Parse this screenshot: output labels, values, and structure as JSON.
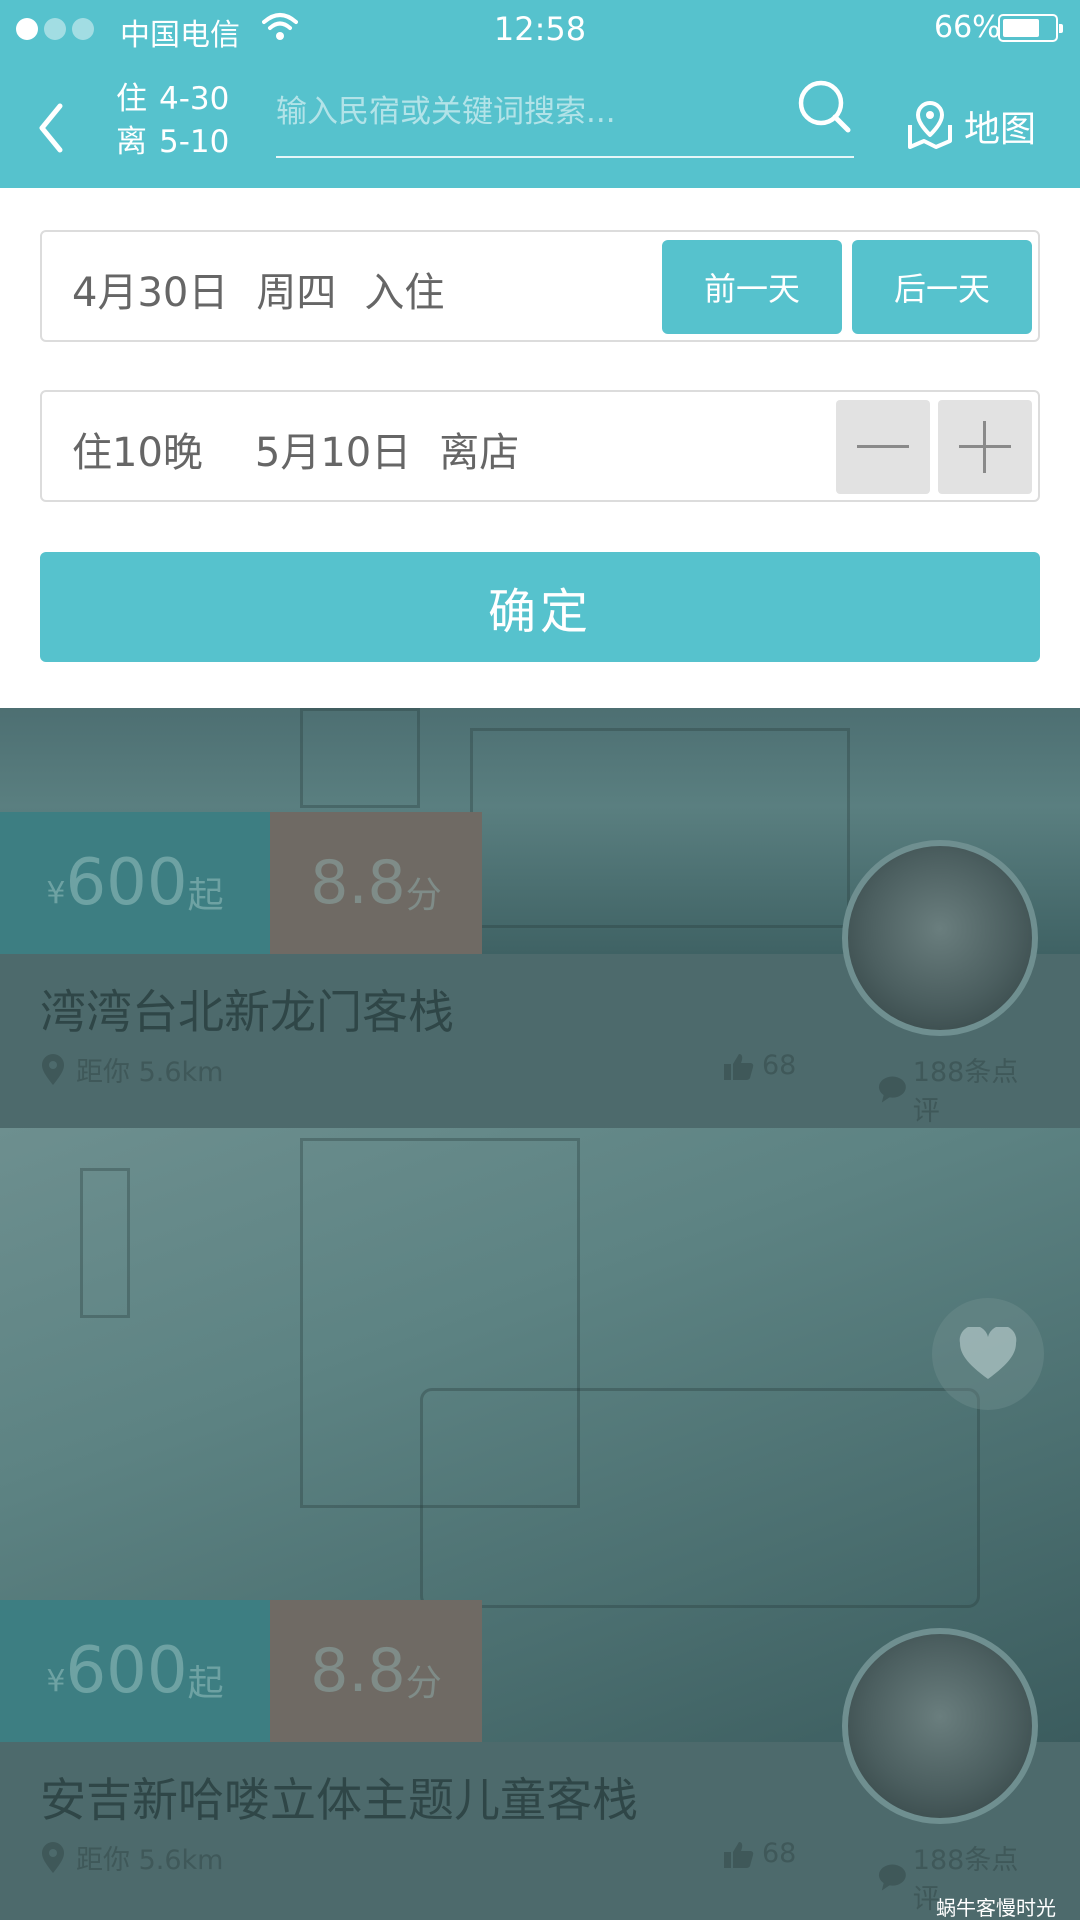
{
  "status_bar": {
    "carrier": "中国电信",
    "time": "12:58",
    "battery": "66%",
    "battery_level": 0.66
  },
  "header": {
    "checkin_key": "住",
    "checkin_value": "4-30",
    "checkout_key": "离",
    "checkout_value": "5-10",
    "search_placeholder": "输入民宿或关键词搜索...",
    "map_label": "地图",
    "icons": [
      "back-icon",
      "search-icon",
      "map-pin-icon"
    ]
  },
  "picker": {
    "checkin": {
      "date": "4月30日",
      "weekday": "周四",
      "action": "入住"
    },
    "prev_day": "前一天",
    "next_day": "后一天",
    "stay": {
      "nights": "住10晚",
      "date": "5月10日",
      "action": "离店"
    },
    "confirm": "确定"
  },
  "listings": [
    {
      "price_symbol": "¥",
      "price": "600",
      "price_suffix": "起",
      "score": "8.8",
      "score_suffix": "分",
      "name": "湾湾台北新龙门客栈",
      "distance": "距你 5.6km",
      "likes": "68",
      "reviews": "188条点评"
    },
    {
      "price_symbol": "¥",
      "price": "600",
      "price_suffix": "起",
      "score": "8.8",
      "score_suffix": "分",
      "name": "安吉新哈喽立体主题儿童客栈",
      "distance": "距你 5.6km",
      "likes": "68",
      "reviews": "188条点评"
    }
  ],
  "watermark": "蜗牛客慢时光",
  "colors": {
    "accent": "#56c2cd",
    "overlay": "#4d6a6c"
  }
}
